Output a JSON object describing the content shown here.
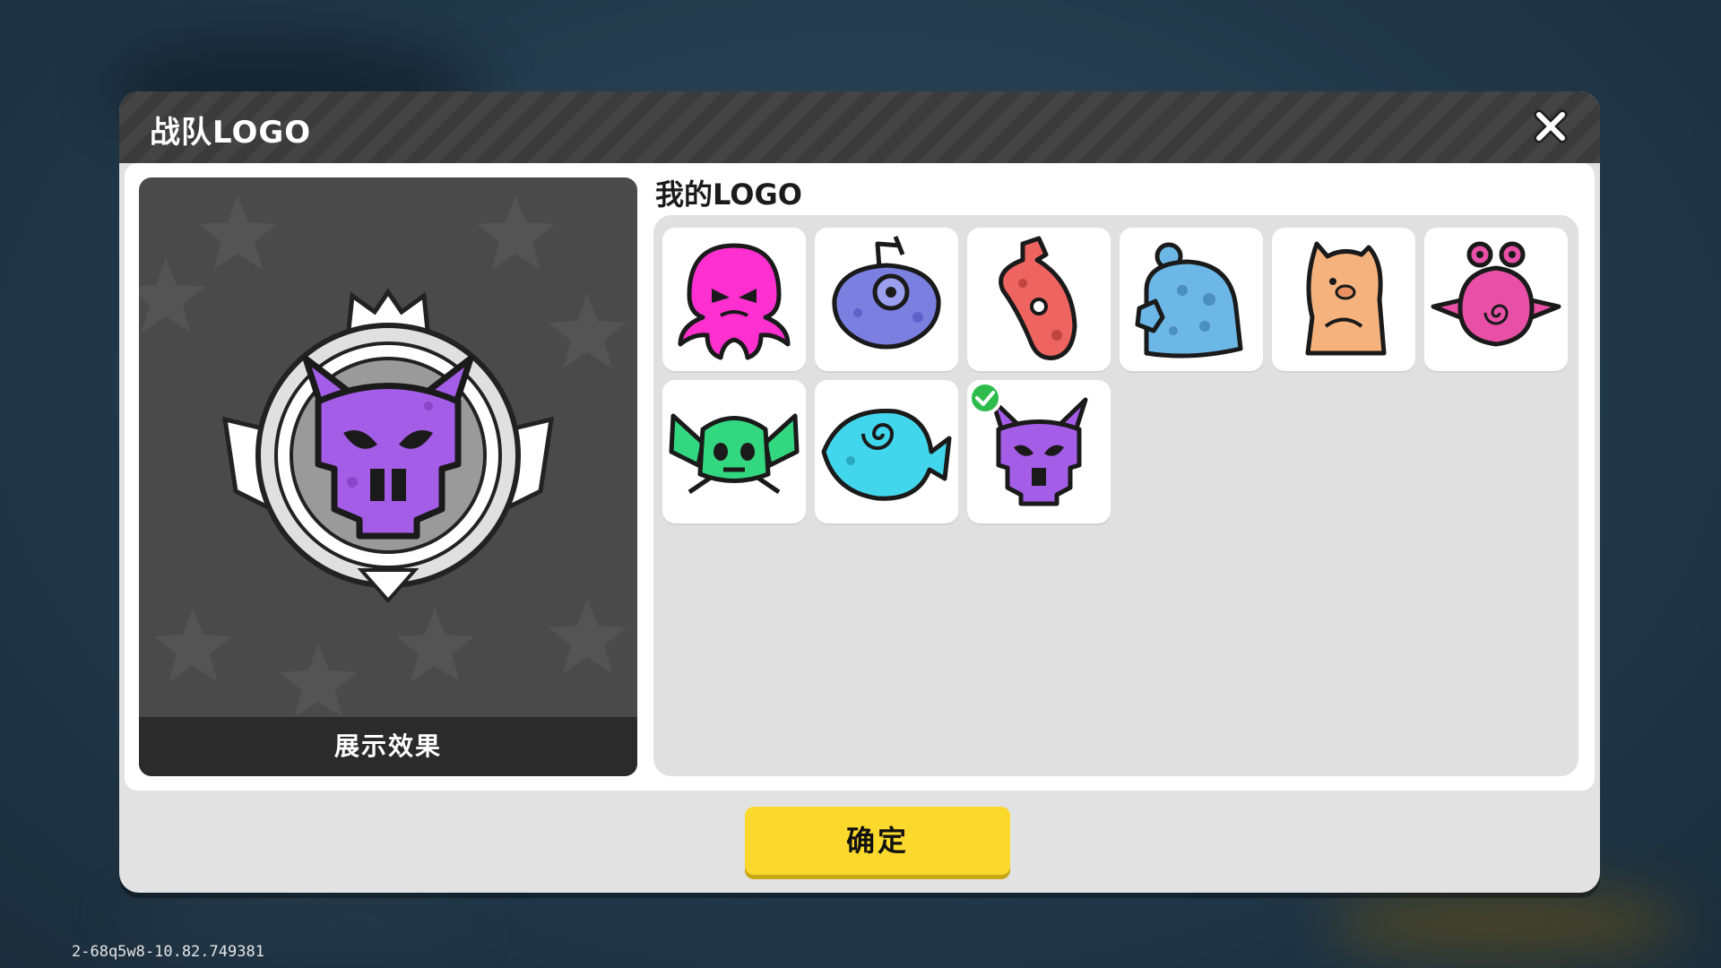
{
  "dialog": {
    "title": "战队LOGO",
    "close_icon": "close-icon"
  },
  "preview": {
    "caption": "展示效果",
    "emblem_icon": "purple-demon-skull-emblem"
  },
  "my_logos": {
    "title": "我的LOGO",
    "selected_index": 8,
    "items": [
      {
        "icon": "pink-octopus-icon",
        "color": "#ff2fd0"
      },
      {
        "icon": "purple-ufo-blob-icon",
        "color": "#7b7fe0"
      },
      {
        "icon": "red-bottle-creature-icon",
        "color": "#ee6460"
      },
      {
        "icon": "blue-robot-helmet-icon",
        "color": "#6cb7e6"
      },
      {
        "icon": "orange-sitting-bear-icon",
        "color": "#f6b27d"
      },
      {
        "icon": "pink-swirl-bug-icon",
        "color": "#e84fa6"
      },
      {
        "icon": "green-winged-skull-icon",
        "color": "#33d77f"
      },
      {
        "icon": "cyan-swirl-fish-icon",
        "color": "#42d6ec"
      },
      {
        "icon": "purple-demon-skull-icon",
        "color": "#a45de6"
      }
    ]
  },
  "buttons": {
    "confirm_label": "确定"
  },
  "footer": {
    "build_id": "2-68q5w8-10.82.749381"
  },
  "colors": {
    "accent_yellow": "#fbd92c",
    "check_green": "#2ebd4d"
  }
}
